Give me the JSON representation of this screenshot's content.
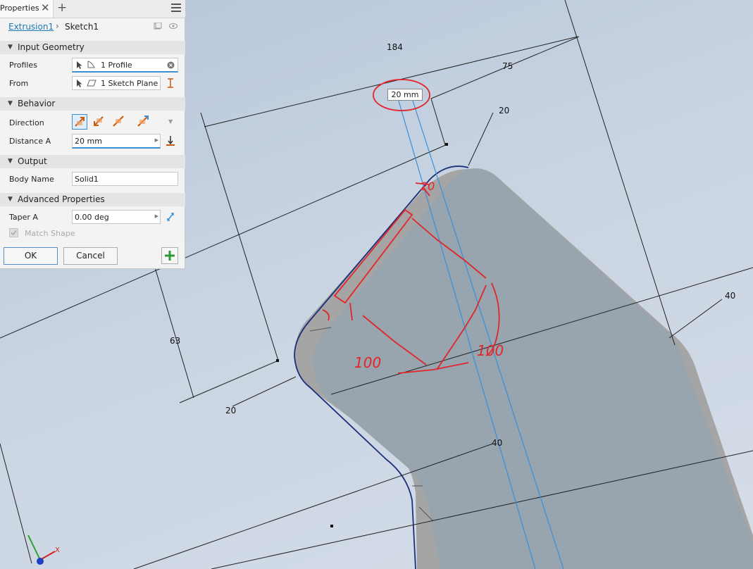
{
  "panel": {
    "tab_title": "Properties",
    "breadcrumb": {
      "parent": "Extrusion1",
      "current": "Sketch1"
    },
    "sections": {
      "input_geometry": "Input Geometry",
      "behavior": "Behavior",
      "output": "Output",
      "advanced": "Advanced Properties"
    },
    "profiles": {
      "label": "Profiles",
      "value": "1 Profile"
    },
    "from": {
      "label": "From",
      "value": "1 Sketch Plane"
    },
    "direction": {
      "label": "Direction"
    },
    "distance_a": {
      "label": "Distance A",
      "value": "20 mm"
    },
    "body_name": {
      "label": "Body Name",
      "value": "Solid1"
    },
    "taper_a": {
      "label": "Taper A",
      "value": "0.00 deg"
    },
    "match_shape": {
      "label": "Match Shape",
      "checked": true,
      "enabled": false
    },
    "buttons": {
      "ok": "OK",
      "cancel": "Cancel"
    }
  },
  "viewport": {
    "dimensions": {
      "d184": "184",
      "d75": "75",
      "d20_top": "20",
      "d63": "63",
      "d20_left": "20",
      "d40_right": "40",
      "d40_bottom": "40"
    },
    "callout": "20 mm",
    "axis_x": "X",
    "markup_colors": {
      "red": "#e0262b",
      "blue_line": "#3a8fd8",
      "edge": "#1c2f7a"
    }
  }
}
